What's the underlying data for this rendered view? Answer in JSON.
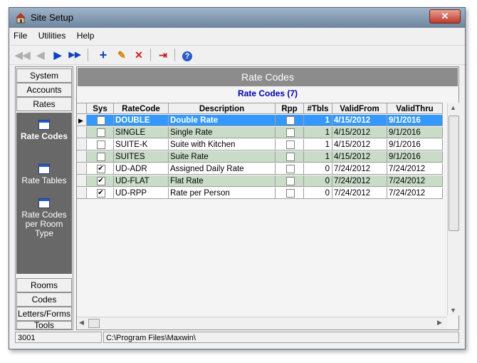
{
  "window": {
    "title": "Site Setup",
    "close_label": "✕"
  },
  "menu": [
    "File",
    "Utilities",
    "Help"
  ],
  "toolbar": {
    "icons": [
      "first-icon",
      "prev-icon",
      "next-icon",
      "last-icon",
      "add-icon",
      "edit-icon",
      "delete-icon",
      "exit-icon",
      "help-icon"
    ]
  },
  "sidebar": {
    "top_buttons": [
      "System",
      "Accounts",
      "Rates"
    ],
    "items": [
      "Rate Codes",
      "Rate Tables",
      "Rate Codes per Room Type"
    ],
    "bottom_buttons": [
      "Rooms",
      "Codes",
      "Letters/Forms",
      "Tools"
    ]
  },
  "panel": {
    "header": "Rate Codes",
    "subtitle": "Rate Codes (7)"
  },
  "table": {
    "columns": [
      "Sys",
      "RateCode",
      "Description",
      "Rpp",
      "#Tbls",
      "ValidFrom",
      "ValidThru"
    ],
    "rows": [
      {
        "sys": false,
        "code": "DOUBLE",
        "desc": "Double Rate",
        "rpp": false,
        "tbls": "1",
        "from": "4/15/2012",
        "thru": "9/1/2016"
      },
      {
        "sys": false,
        "code": "SINGLE",
        "desc": "Single Rate",
        "rpp": false,
        "tbls": "1",
        "from": "4/15/2012",
        "thru": "9/1/2016"
      },
      {
        "sys": false,
        "code": "SUITE-K",
        "desc": "Suite with Kitchen",
        "rpp": false,
        "tbls": "1",
        "from": "4/15/2012",
        "thru": "9/1/2016"
      },
      {
        "sys": false,
        "code": "SUITES",
        "desc": "Suite Rate",
        "rpp": false,
        "tbls": "1",
        "from": "4/15/2012",
        "thru": "9/1/2016"
      },
      {
        "sys": true,
        "code": "UD-ADR",
        "desc": "Assigned Daily Rate",
        "rpp": false,
        "tbls": "0",
        "from": "7/24/2012",
        "thru": "7/24/2012"
      },
      {
        "sys": true,
        "code": "UD-FLAT",
        "desc": "Flat Rate",
        "rpp": false,
        "tbls": "0",
        "from": "7/24/2012",
        "thru": "7/24/2012"
      },
      {
        "sys": true,
        "code": "UD-RPP",
        "desc": "Rate per Person",
        "rpp": false,
        "tbls": "0",
        "from": "7/24/2012",
        "thru": "7/24/2012"
      }
    ]
  },
  "colors": {
    "selected": "#3399ff",
    "alt_row": "#c8dcc8",
    "row": "#ffffff"
  },
  "status": {
    "left": "3001",
    "right": "C:\\Program Files\\Maxwin\\"
  }
}
